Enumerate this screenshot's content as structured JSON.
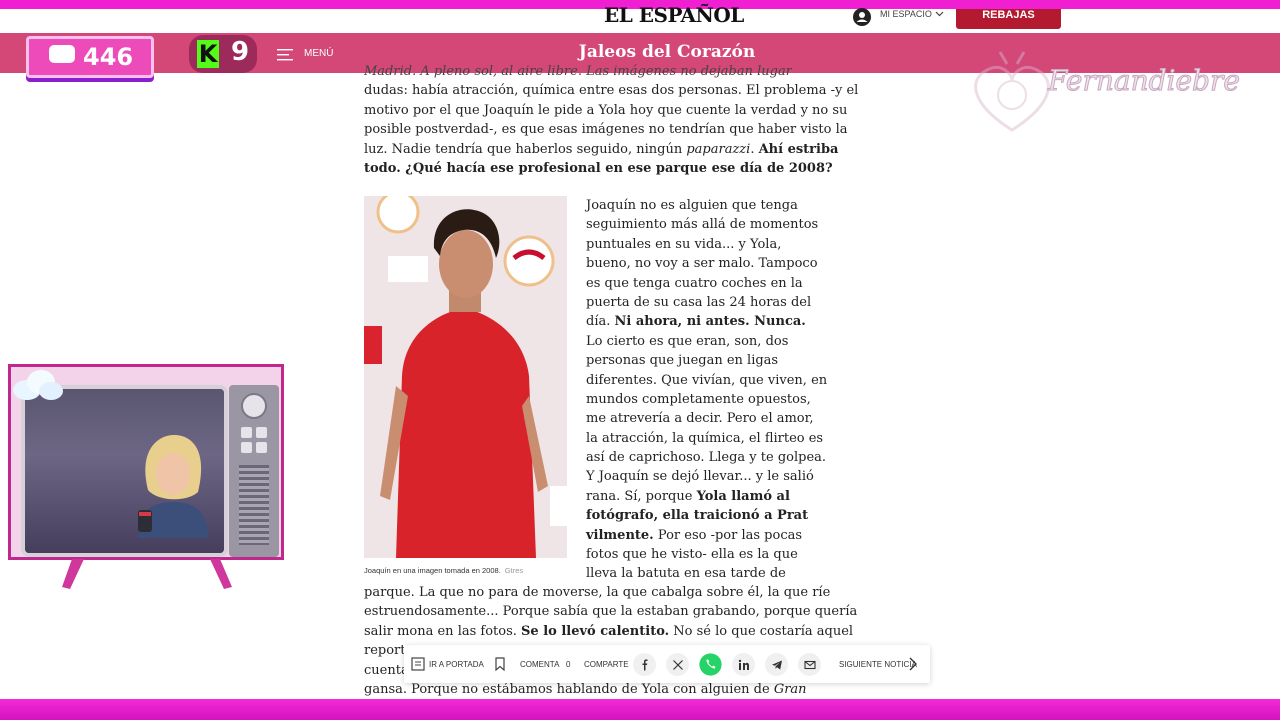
{
  "site": {
    "logo": "EL ESPAÑOL",
    "user_menu": "MI ESPACIO",
    "promo_button": "REBAJAS",
    "menu_label": "MENÚ",
    "section_title": "Jaleos del Corazón"
  },
  "overlay": {
    "chat_count": "446",
    "kick_count": "9",
    "watermark": "Fernandiebre"
  },
  "article": {
    "top_cut": "Madrid. A pleno sol, al aire libre. Las imágenes no dejaban lugar a",
    "top_lines": [
      "dudas: había atracción, química entre esas dos personas. El problema -y el",
      "motivo por el que Joaquín le pide a Yola hoy que cuente la verdad y no su",
      "posible postverdad-, es que esas imágenes no tendrían que haber visto la",
      "luz. Nadie tendría que haberlos seguido, ningún ",
      "paparazzi",
      ". ",
      "Ahí estriba",
      "todo. ¿Qué hacía ese profesional en ese parque ese día de 2008?"
    ],
    "caption": "Joaquín en una imagen tomada en 2008.",
    "caption_source": "Gtres",
    "side_lines": [
      "Joaquín no es alguien que tenga",
      "seguimiento más allá de momentos",
      "puntuales en su vida... y Yola,",
      "bueno, no voy a ser malo. Tampoco",
      "es que tenga cuatro coches en la",
      "puerta de su casa las 24 horas del",
      "día. ",
      "Ni ahora, ni antes. Nunca.",
      "Lo cierto es que eran, son, dos",
      "personas que juegan en ligas",
      "diferentes. Que vivían, que viven, en",
      "mundos completamente opuestos,",
      "me atrevería a decir. Pero el amor,",
      "la atracción, la química, el flirteo es",
      "así de caprichoso. Llega y te golpea.",
      "Y Joaquín se dejó llevar... y le salió",
      "rana. Sí, porque ",
      "Yola llamó al",
      "fotógrafo, ella traicionó a Prat",
      "vilmente.",
      " Por eso -por las pocas",
      "fotos que he visto- ella es la que",
      "lleva la batuta en esa tarde de"
    ],
    "bottom_lines": [
      "parque. La que no para de moverse, la que cabalga sobre él, la que ríe",
      "estruendosamente... Porque sabía que la estaban grabando, porque quería",
      "salir mona en las fotos. ",
      "Se lo llevó calentito.",
      " No sé lo que costaría aquel",
      "reporta",
      "cuenta",
      "gansa. Porque no estábamos hablando de Yola con alguien de ",
      "Gran"
    ]
  },
  "sharebar": {
    "home": "IR A PORTADA",
    "comments_label": "COMENTA",
    "comments_count": "0",
    "share_label": "COMPARTE",
    "next": "SIGUIENTE NOTICIA"
  },
  "colors": {
    "section_bar": "#d44878",
    "promo": "#b3192f",
    "stream_border": "#f01fd2"
  }
}
